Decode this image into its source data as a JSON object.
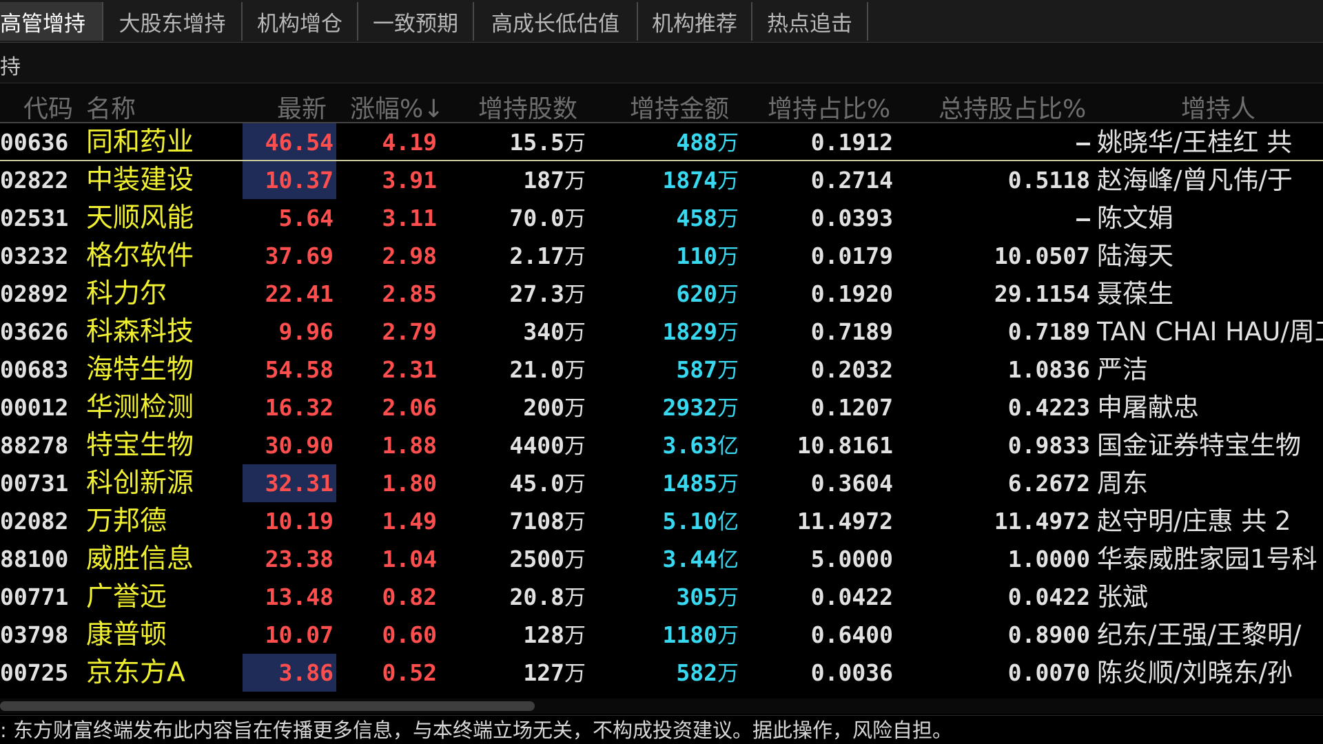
{
  "tabs": [
    {
      "label": "高管增持",
      "active": true
    },
    {
      "label": "大股东增持",
      "active": false
    },
    {
      "label": "机构增仓",
      "active": false
    },
    {
      "label": "一致预期",
      "active": false
    },
    {
      "label": "高成长低估值",
      "active": false
    },
    {
      "label": "机构推荐",
      "active": false
    },
    {
      "label": "热点追击",
      "active": false
    }
  ],
  "subtitle": "持",
  "columns": {
    "code": "代码",
    "name": "名称",
    "price": "最新",
    "change": "涨幅%↓",
    "shares": "增持股数",
    "amount": "增持金额",
    "ratio": "增持占比%",
    "total": "总持股占比%",
    "person": "增持人"
  },
  "rows": [
    {
      "code": "00636",
      "name": "同和药业",
      "price": "46.54",
      "change": "4.19",
      "shares": "15.5",
      "shares_unit": "万",
      "amount": "488",
      "amount_unit": "万",
      "ratio": "0.1912",
      "total": "—",
      "person": "姚晓华/王桂红 共",
      "highlight": true,
      "selected": true
    },
    {
      "code": "02822",
      "name": "中装建设",
      "price": "10.37",
      "change": "3.91",
      "shares": "187",
      "shares_unit": "万",
      "amount": "1874",
      "amount_unit": "万",
      "ratio": "0.2714",
      "total": "0.5118",
      "person": "赵海峰/曾凡伟/于",
      "highlight": true,
      "selected": false
    },
    {
      "code": "02531",
      "name": "天顺风能",
      "price": "5.64",
      "change": "3.11",
      "shares": "70.0",
      "shares_unit": "万",
      "amount": "458",
      "amount_unit": "万",
      "ratio": "0.0393",
      "total": "—",
      "person": "陈文娟",
      "highlight": false,
      "selected": false
    },
    {
      "code": "03232",
      "name": "格尔软件",
      "price": "37.69",
      "change": "2.98",
      "shares": "2.17",
      "shares_unit": "万",
      "amount": "110",
      "amount_unit": "万",
      "ratio": "0.0179",
      "total": "10.0507",
      "person": "陆海天",
      "highlight": false,
      "selected": false
    },
    {
      "code": "02892",
      "name": "科力尔",
      "price": "22.41",
      "change": "2.85",
      "shares": "27.3",
      "shares_unit": "万",
      "amount": "620",
      "amount_unit": "万",
      "ratio": "0.1920",
      "total": "29.1154",
      "person": "聂葆生",
      "highlight": false,
      "selected": false
    },
    {
      "code": "03626",
      "name": "科森科技",
      "price": "9.96",
      "change": "2.79",
      "shares": "340",
      "shares_unit": "万",
      "amount": "1829",
      "amount_unit": "万",
      "ratio": "0.7189",
      "total": "0.7189",
      "person": "TAN CHAI HAU/周工",
      "highlight": false,
      "selected": false
    },
    {
      "code": "00683",
      "name": "海特生物",
      "price": "54.58",
      "change": "2.31",
      "shares": "21.0",
      "shares_unit": "万",
      "amount": "587",
      "amount_unit": "万",
      "ratio": "0.2032",
      "total": "1.0836",
      "person": "严洁",
      "highlight": false,
      "selected": false
    },
    {
      "code": "00012",
      "name": "华测检测",
      "price": "16.32",
      "change": "2.06",
      "shares": "200",
      "shares_unit": "万",
      "amount": "2932",
      "amount_unit": "万",
      "ratio": "0.1207",
      "total": "0.4223",
      "person": "申屠献忠",
      "highlight": false,
      "selected": false
    },
    {
      "code": "88278",
      "name": "特宝生物",
      "price": "30.90",
      "change": "1.88",
      "shares": "4400",
      "shares_unit": "万",
      "amount": "3.63",
      "amount_unit": "亿",
      "ratio": "10.8161",
      "total": "0.9833",
      "person": "国金证券特宝生物",
      "highlight": false,
      "selected": false
    },
    {
      "code": "00731",
      "name": "科创新源",
      "price": "32.31",
      "change": "1.80",
      "shares": "45.0",
      "shares_unit": "万",
      "amount": "1485",
      "amount_unit": "万",
      "ratio": "0.3604",
      "total": "6.2672",
      "person": "周东",
      "highlight": true,
      "selected": false
    },
    {
      "code": "02082",
      "name": "万邦德",
      "price": "10.19",
      "change": "1.49",
      "shares": "7108",
      "shares_unit": "万",
      "amount": "5.10",
      "amount_unit": "亿",
      "ratio": "11.4972",
      "total": "11.4972",
      "person": "赵守明/庄惠 共 2",
      "highlight": false,
      "selected": false
    },
    {
      "code": "88100",
      "name": "威胜信息",
      "price": "23.38",
      "change": "1.04",
      "shares": "2500",
      "shares_unit": "万",
      "amount": "3.44",
      "amount_unit": "亿",
      "ratio": "5.0000",
      "total": "1.0000",
      "person": "华泰威胜家园1号科",
      "highlight": false,
      "selected": false
    },
    {
      "code": "00771",
      "name": "广誉远",
      "price": "13.48",
      "change": "0.82",
      "shares": "20.8",
      "shares_unit": "万",
      "amount": "305",
      "amount_unit": "万",
      "ratio": "0.0422",
      "total": "0.0422",
      "person": "张斌",
      "highlight": false,
      "selected": false
    },
    {
      "code": "03798",
      "name": "康普顿",
      "price": "10.07",
      "change": "0.60",
      "shares": "128",
      "shares_unit": "万",
      "amount": "1180",
      "amount_unit": "万",
      "ratio": "0.6400",
      "total": "0.8900",
      "person": "纪东/王强/王黎明/",
      "highlight": false,
      "selected": false
    },
    {
      "code": "00725",
      "name": "京东方A",
      "price": "3.86",
      "change": "0.52",
      "shares": "127",
      "shares_unit": "万",
      "amount": "582",
      "amount_unit": "万",
      "ratio": "0.0036",
      "total": "0.0070",
      "person": "陈炎顺/刘晓东/孙",
      "highlight": true,
      "selected": false
    }
  ],
  "footer": ": 东方财富终端发布此内容旨在传播更多信息，与本终端立场无关，不构成投资建议。据此操作，风险自担。",
  "colors": {
    "up": "#ff4e4e",
    "amount": "#37d8f0",
    "name": "#f0f030",
    "highlight": "#1f2c58"
  }
}
